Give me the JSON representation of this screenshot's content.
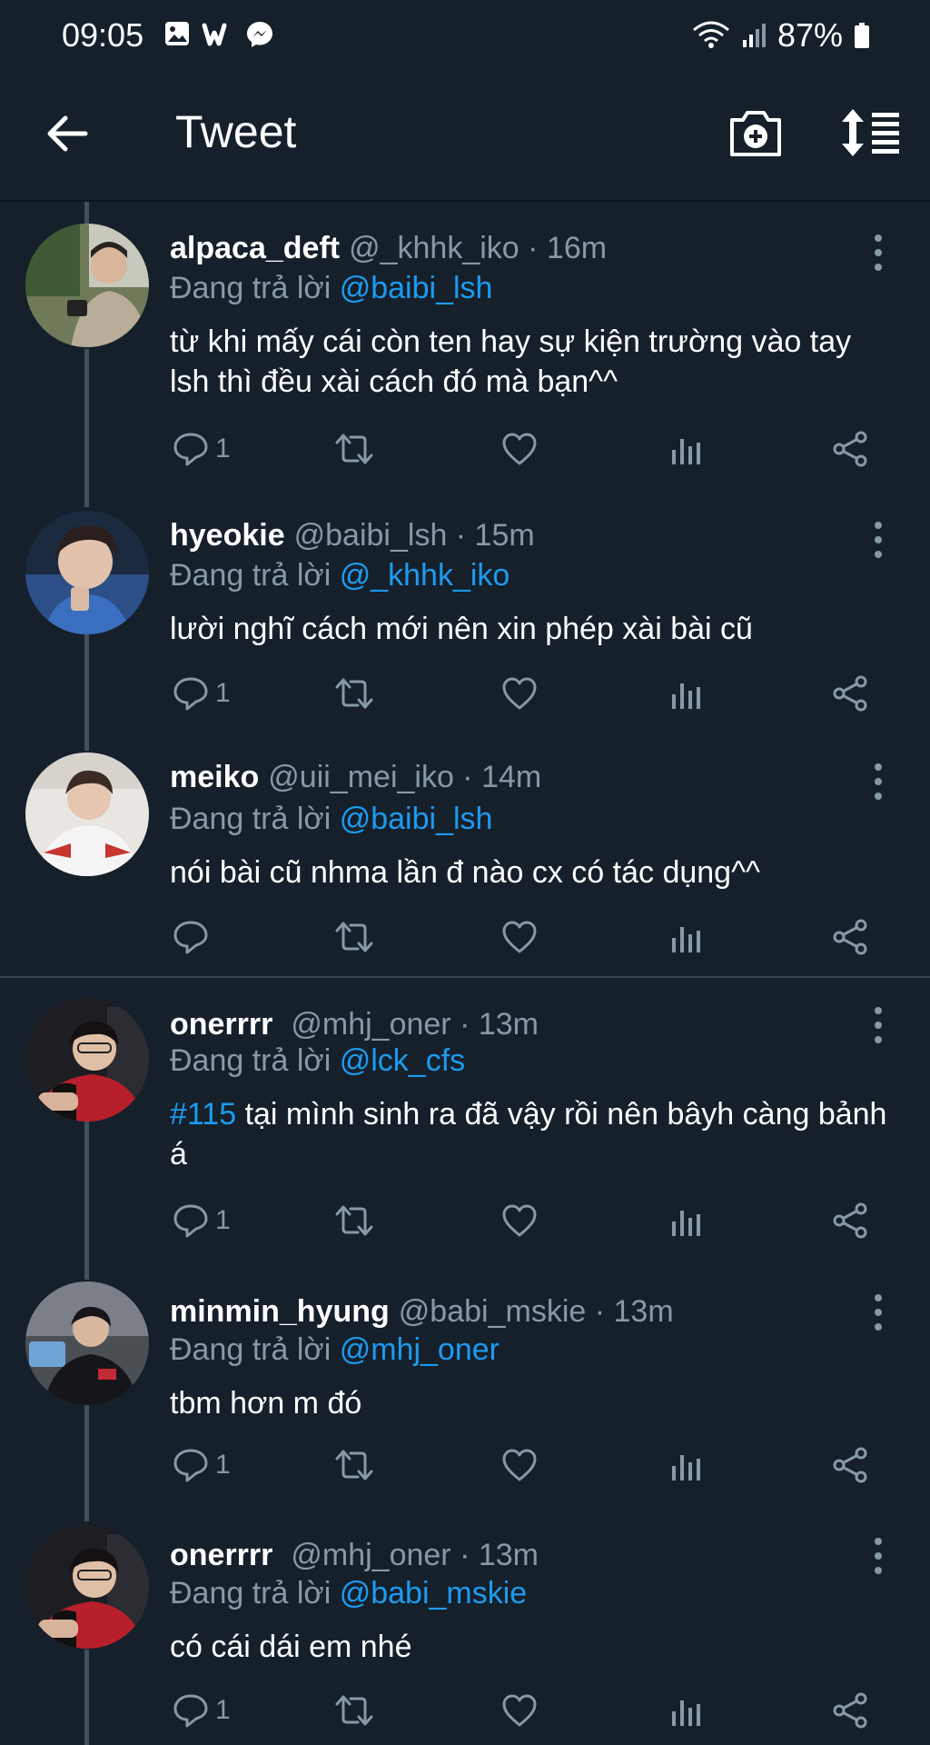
{
  "status_bar": {
    "time": "09:05",
    "battery": "87%",
    "left_icons": [
      "gallery-icon",
      "wattpad-icon",
      "messenger-icon"
    ],
    "right_icons": [
      "wifi-icon",
      "signal-icon",
      "battery-icon"
    ]
  },
  "app_bar": {
    "title": "Tweet",
    "back_icon": "arrow-left-icon",
    "camera_icon": "camera-plus-icon",
    "sort_icon": "sort-icon"
  },
  "colors": {
    "background": "#15202b",
    "accent": "#1d9bf0",
    "muted": "#8899a6"
  },
  "tweets": [
    {
      "name": "alpaca_deft",
      "handle": "@_khhk_iko · 16m",
      "reply_prefix": "Đang trả lời",
      "reply_to": "@baibi_lsh",
      "text": "từ khi mấy cái còn ten hay sự kiện trường vào tay lsh thì đều xài cách đó mà bạn^^",
      "reply_count": "1"
    },
    {
      "name": "hyeokie",
      "handle": "@baibi_lsh · 15m",
      "reply_prefix": "Đang trả lời",
      "reply_to": "@_khhk_iko",
      "text": "lười nghĩ cách mới nên xin phép xài bài cũ",
      "reply_count": "1"
    },
    {
      "name": "meiko",
      "handle": "@uii_mei_iko · 14m",
      "reply_prefix": "Đang trả lời",
      "reply_to": "@baibi_lsh",
      "text": "nói bài cũ nhma lần đ nào cx có tác dụng^^",
      "reply_count": ""
    },
    {
      "name": "onerrrr",
      "handle": "@mhj_oner · 13m",
      "reply_prefix": "Đang trả lời",
      "reply_to": "@lck_cfs",
      "hashtag": "#115",
      "text": " tại mình sinh ra đã vậy rồi nên bâyh càng bảnh á",
      "reply_count": "1"
    },
    {
      "name": "minmin_hyung",
      "handle": "@babi_mskie · 13m",
      "reply_prefix": "Đang trả lời",
      "reply_to": "@mhj_oner",
      "text": "tbm hơn m đó",
      "reply_count": "1"
    },
    {
      "name": "onerrrr",
      "handle": "@mhj_oner · 13m",
      "reply_prefix": "Đang trả lời",
      "reply_to": "@babi_mskie",
      "text": "có cái dái em nhé",
      "reply_count": "1"
    }
  ],
  "action_icons": [
    "reply-icon",
    "retweet-icon",
    "like-icon",
    "analytics-icon",
    "share-icon"
  ]
}
